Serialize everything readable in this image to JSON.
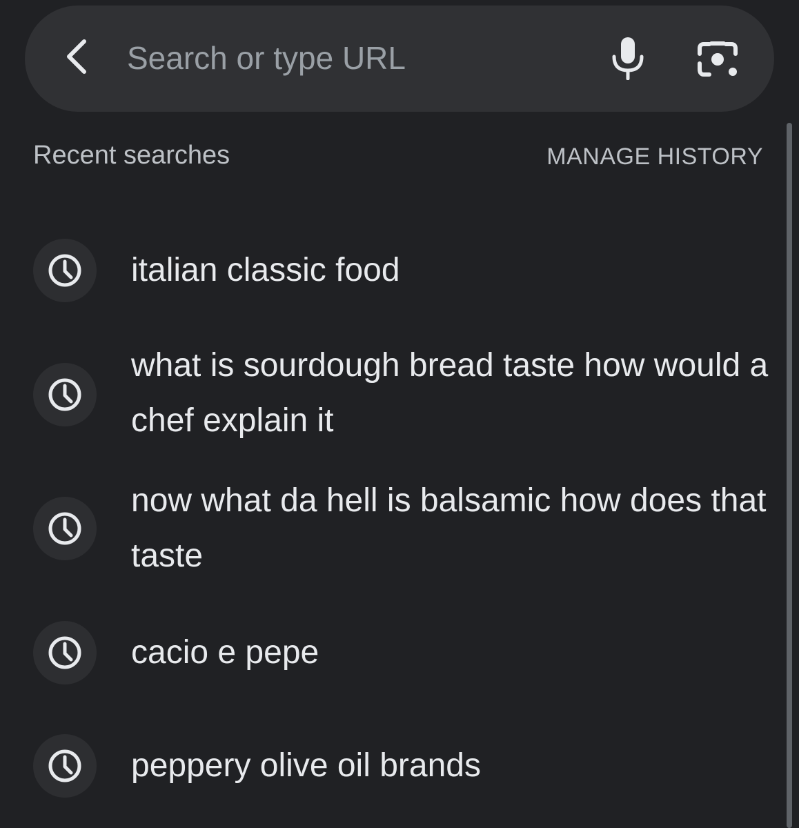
{
  "search": {
    "placeholder": "Search or type URL",
    "back_icon": "back-chevron-icon",
    "mic_icon": "microphone-icon",
    "lens_icon": "lens-camera-icon"
  },
  "recent": {
    "title": "Recent searches",
    "manage_label": "MANAGE HISTORY",
    "items": [
      {
        "text": "italian classic food",
        "icon": "history-clock-icon"
      },
      {
        "text": "what is sourdough bread taste how would a chef explain it",
        "icon": "history-clock-icon"
      },
      {
        "text": "now what da hell is balsamic how does that taste",
        "icon": "history-clock-icon"
      },
      {
        "text": "cacio e pepe",
        "icon": "history-clock-icon"
      },
      {
        "text": "peppery olive oil brands",
        "icon": "history-clock-icon"
      }
    ]
  },
  "colors": {
    "background": "#202124",
    "search_bar": "#303134",
    "icon_circle": "#2d2e31",
    "text_primary": "#e8eaed",
    "text_secondary": "#bdc1c6",
    "placeholder": "#9aa0a6"
  }
}
